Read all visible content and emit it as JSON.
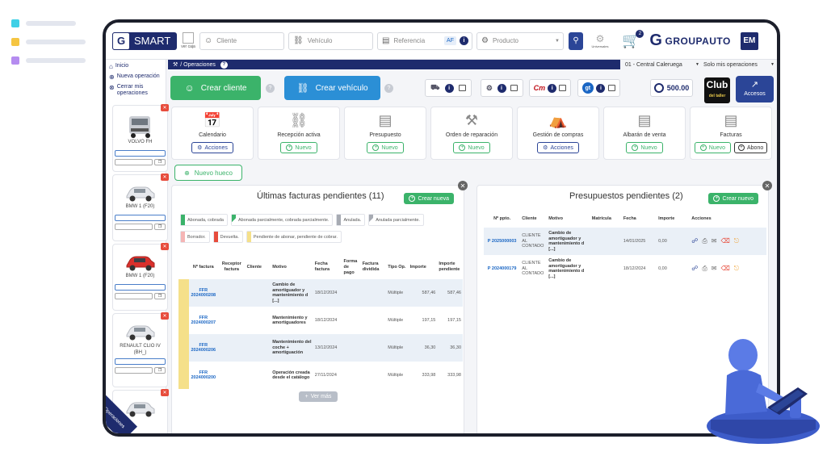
{
  "header": {
    "logo_text": "SMART",
    "ver_caja": "ver caja",
    "cliente_placeholder": "Cliente",
    "vehiculo_placeholder": "Vehículo",
    "referencia_placeholder": "Referencia",
    "af_label": "AF",
    "producto_placeholder": "Producto",
    "universales": "Universales",
    "cart_count": "2",
    "brand": "GROUPAUTO",
    "user_initials": "EM"
  },
  "nav": {
    "items": [
      {
        "label": "Inicio"
      },
      {
        "label": "Nueva operación"
      },
      {
        "label": "Cerrar mis operaciones"
      }
    ],
    "vehicles": [
      {
        "name": "VOLVO FH",
        "color": "#d8dbe0"
      },
      {
        "name": "BMW 1 (F20)",
        "color": "#e6e8ec"
      },
      {
        "name": "BMW 1 (F20)",
        "color": "#d9302c"
      },
      {
        "name": "RENAULT CLIO IV (BH_)",
        "color": "#e6e8ec"
      },
      {
        "name": "",
        "color": "#e6e8ec"
      }
    ],
    "ops_tab": "Operaciones"
  },
  "breadcrumb": {
    "label": "/ Operaciones",
    "site_select": "01 - Central Caleruega",
    "filter_select": "Solo mis operaciones"
  },
  "actions": {
    "crear_cliente": "Crear cliente",
    "crear_vehiculo": "Crear vehículo",
    "points": "500.00",
    "club_line1": "Club",
    "club_line2": "del taller",
    "accesos": "Accesos"
  },
  "cards": [
    {
      "title": "Calendario",
      "buttons": [
        "Acciones"
      ],
      "icon": "calendar-icon"
    },
    {
      "title": "Recepción activa",
      "buttons": [
        "Nuevo"
      ],
      "icon": "car-check-icon"
    },
    {
      "title": "Presupuesto",
      "buttons": [
        "Nuevo"
      ],
      "icon": "document-icon"
    },
    {
      "title": "Orden de reparación",
      "buttons": [
        "Nuevo"
      ],
      "icon": "tools-icon"
    },
    {
      "title": "Gestión de compras",
      "buttons": [
        "Acciones"
      ],
      "icon": "purchases-icon"
    },
    {
      "title": "Albarán de venta",
      "buttons": [
        "Nuevo"
      ],
      "icon": "delivery-note-icon"
    },
    {
      "title": "Facturas",
      "buttons": [
        "Nuevo",
        "Abono"
      ],
      "icon": "invoice-icon"
    }
  ],
  "nuevo_hueco": "Nuevo hueco",
  "facturas": {
    "title": "Últimas facturas pendientes (11)",
    "crear": "Crear nueva",
    "legend": [
      {
        "label": "Abonada, cobrada",
        "color": "#3bb36a"
      },
      {
        "label": "Abonada parcialmente, cobrada parcialmente.",
        "color": "#7fd39b"
      },
      {
        "label": "Anulada.",
        "color": "#a7abb3"
      },
      {
        "label": "Anulada parcialmente.",
        "color": "#d2d5da"
      },
      {
        "label": "Borrador.",
        "color": "#f5b5b5"
      },
      {
        "label": "Devuelta.",
        "color": "#e74c3c"
      },
      {
        "label": "Pendiente de abonar, pendiente de cobrar.",
        "color": "#f5e08a"
      }
    ],
    "columns": [
      "Nº factura",
      "Receptor factura",
      "Cliente",
      "Motivo",
      "Fecha factura",
      "Forma de pago",
      "Factura dividida",
      "Tipo Op.",
      "Importe",
      "Importe pendiente"
    ],
    "rows": [
      {
        "num": "FFR 2024000208",
        "motivo": "Cambio de amortiguador y mantenimiento d [...]",
        "fecha": "18/12/2024",
        "tipo": "Múltiple",
        "importe": "587,46",
        "pendiente": "587,46"
      },
      {
        "num": "FFR 2024000207",
        "motivo": "Mantenimiento y amortiguadores",
        "fecha": "18/12/2024",
        "tipo": "Múltiple",
        "importe": "197,15",
        "pendiente": "197,15"
      },
      {
        "num": "FFR 2024000206",
        "motivo": "Mantenimiento del coche + amortiguación",
        "fecha": "13/12/2024",
        "tipo": "Múltiple",
        "importe": "36,30",
        "pendiente": "36,30"
      },
      {
        "num": "FFR 2024000200",
        "motivo": "Operación creada desde el catálogo",
        "fecha": "27/11/2024",
        "tipo": "Múltiple",
        "importe": "333,98",
        "pendiente": "333,98"
      }
    ],
    "ver_mas": "Ver más"
  },
  "presupuestos": {
    "title": "Presupuestos pendientes (2)",
    "crear": "Crear nuevo",
    "columns": [
      "Nº ppto.",
      "Cliente",
      "Motivo",
      "Matrícula",
      "Fecha",
      "Importe",
      "Acciones"
    ],
    "rows": [
      {
        "num": "P 2025000003",
        "cliente": "CLIENTE AL CONTADO",
        "motivo": "Cambio de amortiguador y mantenimiento d [...]",
        "fecha": "14/01/2025",
        "importe": "0,00"
      },
      {
        "num": "P 2024000179",
        "cliente": "CLIENTE AL CONTADO",
        "motivo": "Cambio de amortiguador y mantenimiento d [...]",
        "fecha": "18/12/2024",
        "importe": "0,00"
      }
    ]
  },
  "colors": {
    "navy": "#1e2b6d",
    "green": "#3bb36a",
    "blue": "#2b8fd6",
    "red": "#e74c3c",
    "deco_cyan": "#3fd0e6",
    "deco_yellow": "#f5c542",
    "deco_purple": "#b58cf0"
  }
}
